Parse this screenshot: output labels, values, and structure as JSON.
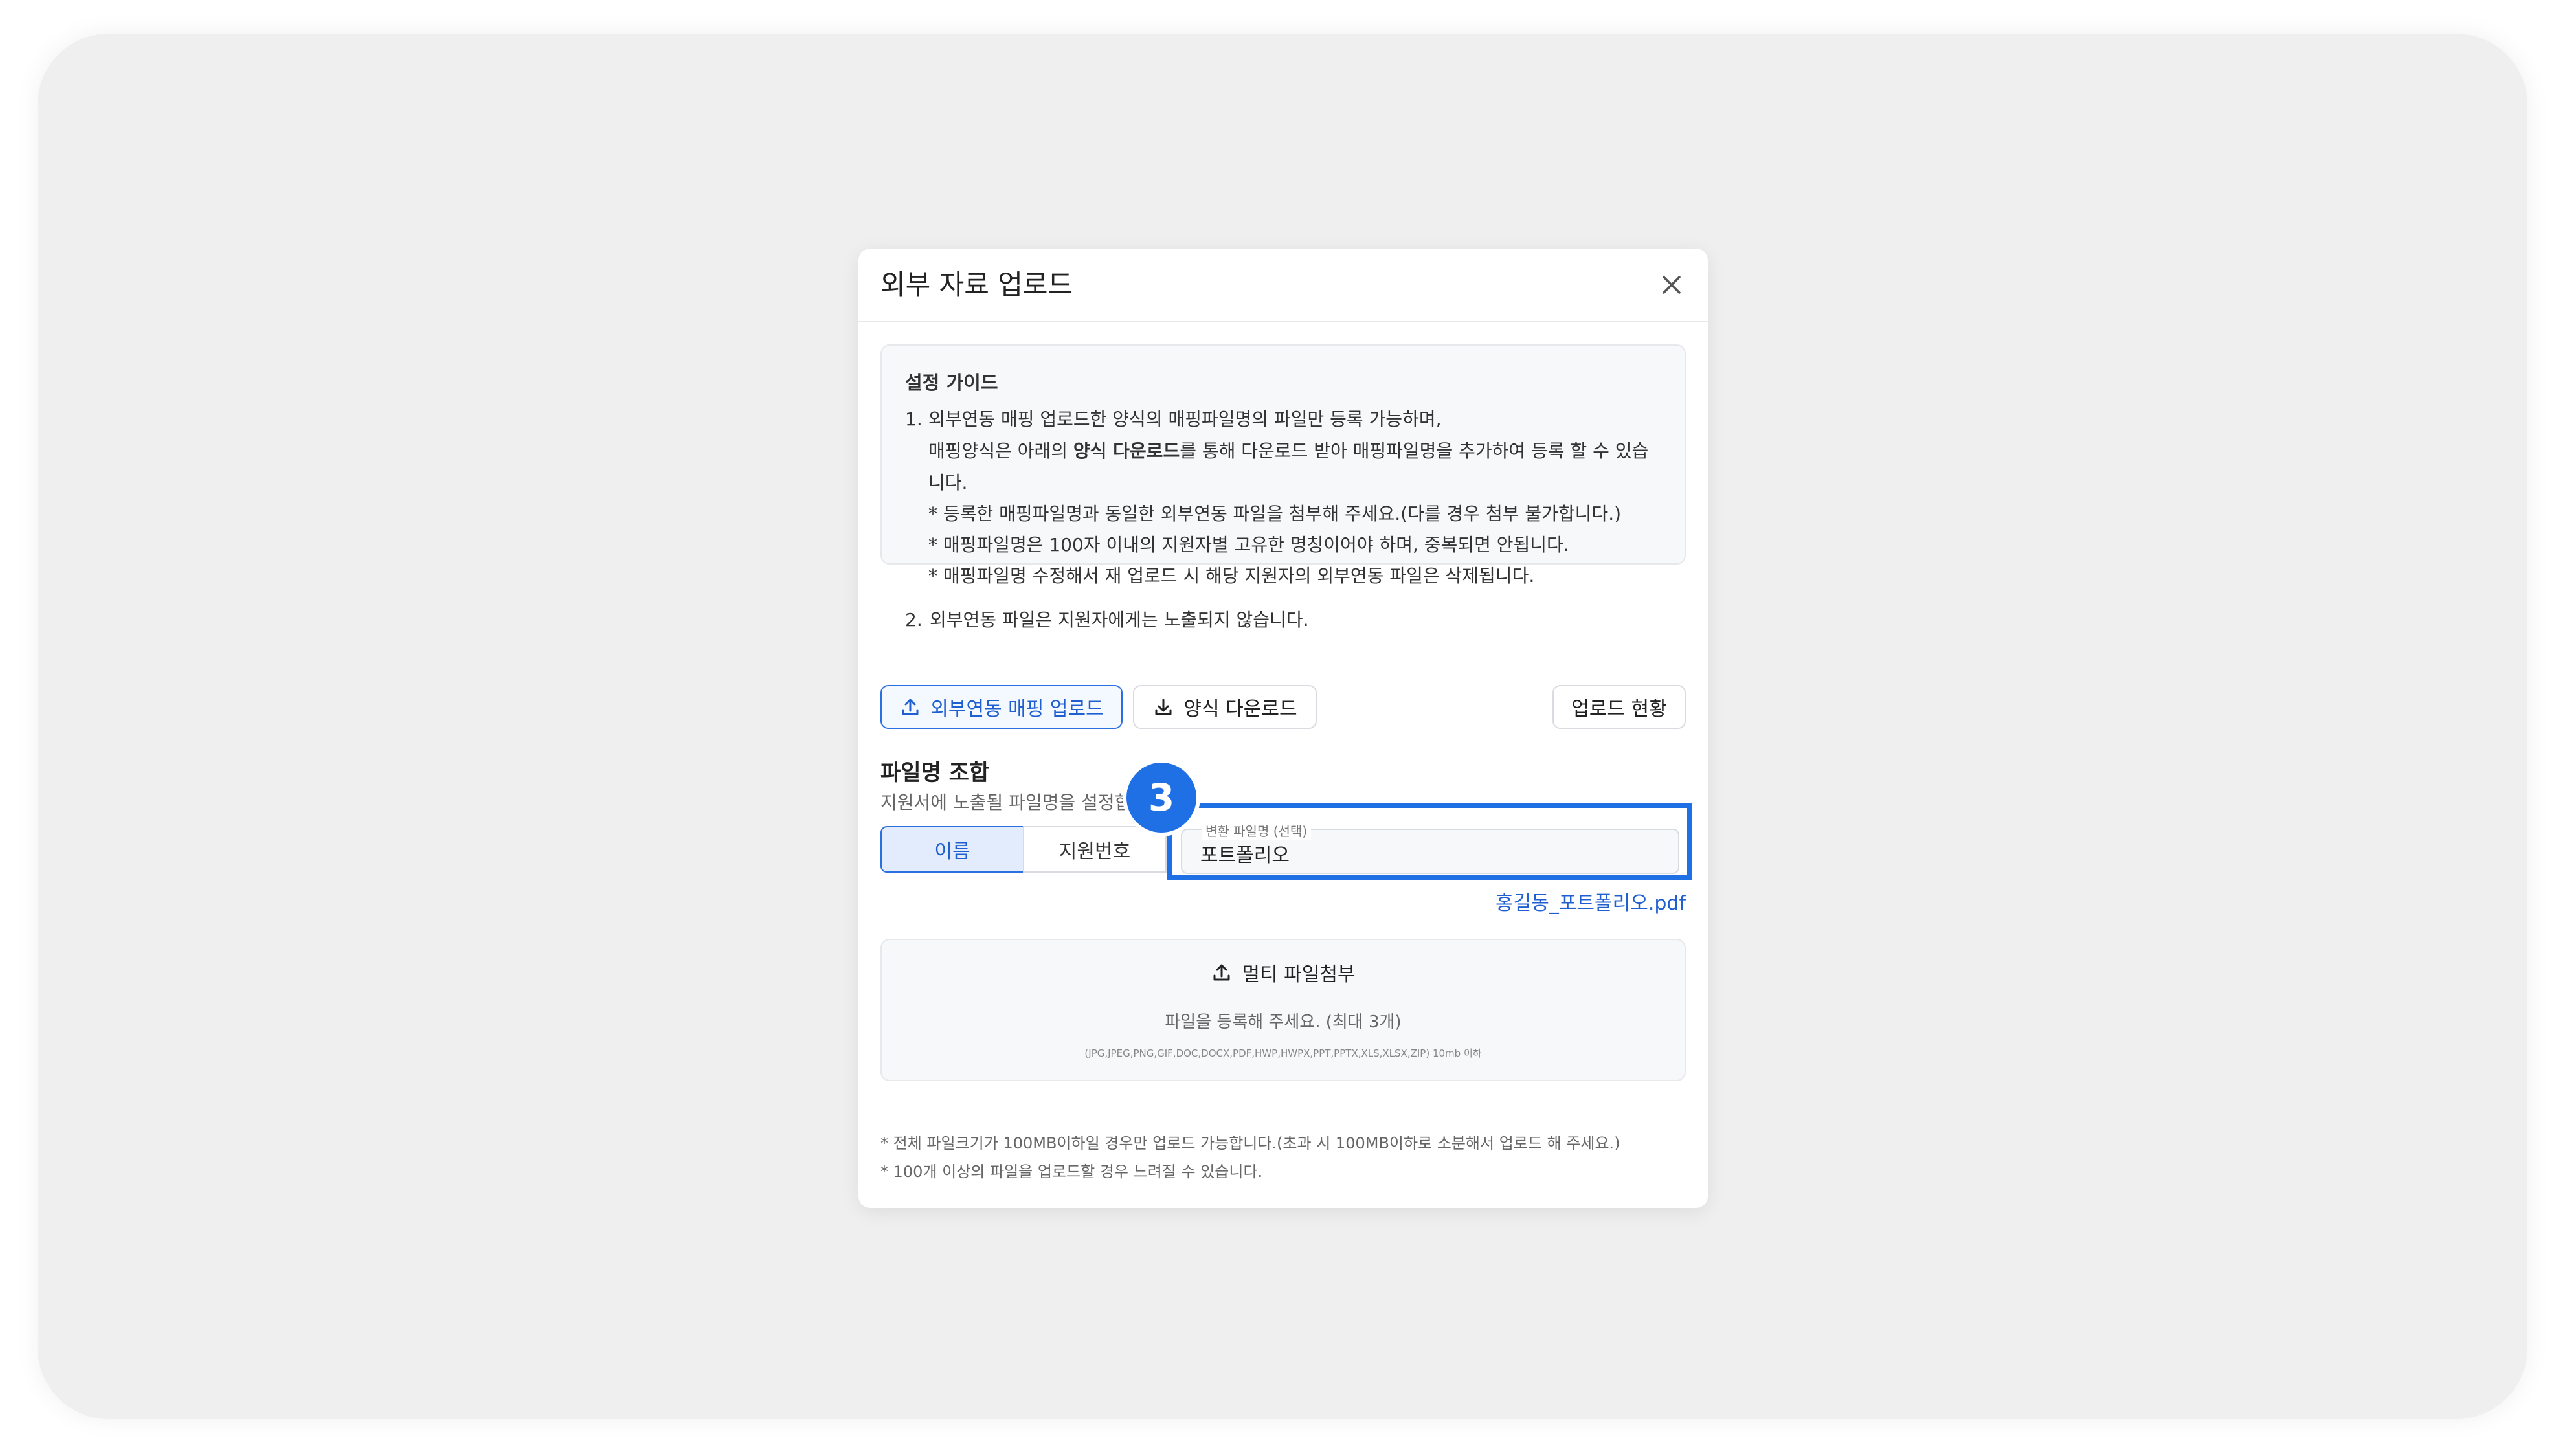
{
  "modal": {
    "title": "외부 자료 업로드"
  },
  "guide": {
    "title": "설정 가이드",
    "item1_num": "1.",
    "item1_line1": "외부연동 매핑 업로드한 양식의 매핑파일명의 파일만 등록 가능하며,",
    "item1_line2_pre": "매핑양식은 아래의 ",
    "item1_line2_bold": "양식 다운로드",
    "item1_line2_post": "를 통해 다운로드 받아 매핑파일명을 추가하여 등록 할 수 있습",
    "item1_line3": "니다.",
    "note_a": "* 등록한 매핑파일명과 동일한 외부연동 파일을 첨부해 주세요.(다를 경우 첨부 불가합니다.)",
    "note_b": "* 매핑파일명은 100자 이내의 지원자별 고유한 명칭이어야 하며, 중복되면 안됩니다.",
    "note_c": "* 매핑파일명 수정해서 재 업로드 시 해당 지원자의 외부연동 파일은 삭제됩니다.",
    "item2_num": "2.",
    "item2_text": "외부연동 파일은 지원자에게는 노출되지 않습니다."
  },
  "actions": {
    "mapping_upload": "외부연동 매핑 업로드",
    "template_download": "양식 다운로드",
    "upload_status": "업로드 현황"
  },
  "filename": {
    "title": "파일명 조합",
    "desc": "지원서에 노출될 파일명을 설정합",
    "segments": [
      "이름",
      "지원번호"
    ],
    "active_segment": "이름",
    "field_label": "변환 파일명 (선택)",
    "field_value": "포트폴리오",
    "preview": "홍길동_포트폴리오.pdf"
  },
  "step_badge": "3",
  "dropzone": {
    "title": "멀티 파일첨부",
    "desc": "파일을 등록해 주세요. (최대 3개)",
    "formats": "(JPG,JPEG,PNG,GIF,DOC,DOCX,PDF,HWP,HWPX,PPT,PPTX,XLS,XLSX,ZIP) 10mb 이하"
  },
  "notes": [
    "* 전체 파일크기가 100MB이하일 경우만 업로드 가능합니다.(초과 시 100MB이하로 소분해서 업로드 해 주세요.)",
    "* 100개 이상의 파일을 업로드할 경우 느려질 수 있습니다."
  ],
  "colors": {
    "accent": "#1f6fe5",
    "link": "#1f5fd0",
    "active_segment_bg": "#e3ecfc"
  }
}
